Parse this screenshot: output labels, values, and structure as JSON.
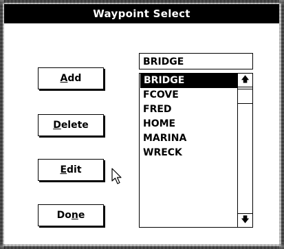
{
  "window": {
    "title": "Waypoint Select"
  },
  "buttons": {
    "add": {
      "prefix": "",
      "mnemonic": "A",
      "suffix": "dd"
    },
    "delete": {
      "prefix": "",
      "mnemonic": "D",
      "suffix": "elete"
    },
    "edit": {
      "prefix": "",
      "mnemonic": "E",
      "suffix": "dit"
    },
    "done": {
      "prefix": "Do",
      "mnemonic": "n",
      "suffix": "e"
    }
  },
  "selection_field": {
    "value": "BRIDGE"
  },
  "waypoints": {
    "selected": "BRIDGE",
    "items": [
      "BRIDGE",
      "FCOVE",
      "FRED",
      "HOME",
      "MARINA",
      "WRECK"
    ]
  },
  "scrollbar": {
    "up_icon": "arrow-up-icon",
    "down_icon": "arrow-down-icon"
  },
  "cursor": {
    "icon": "mouse-pointer-icon"
  }
}
